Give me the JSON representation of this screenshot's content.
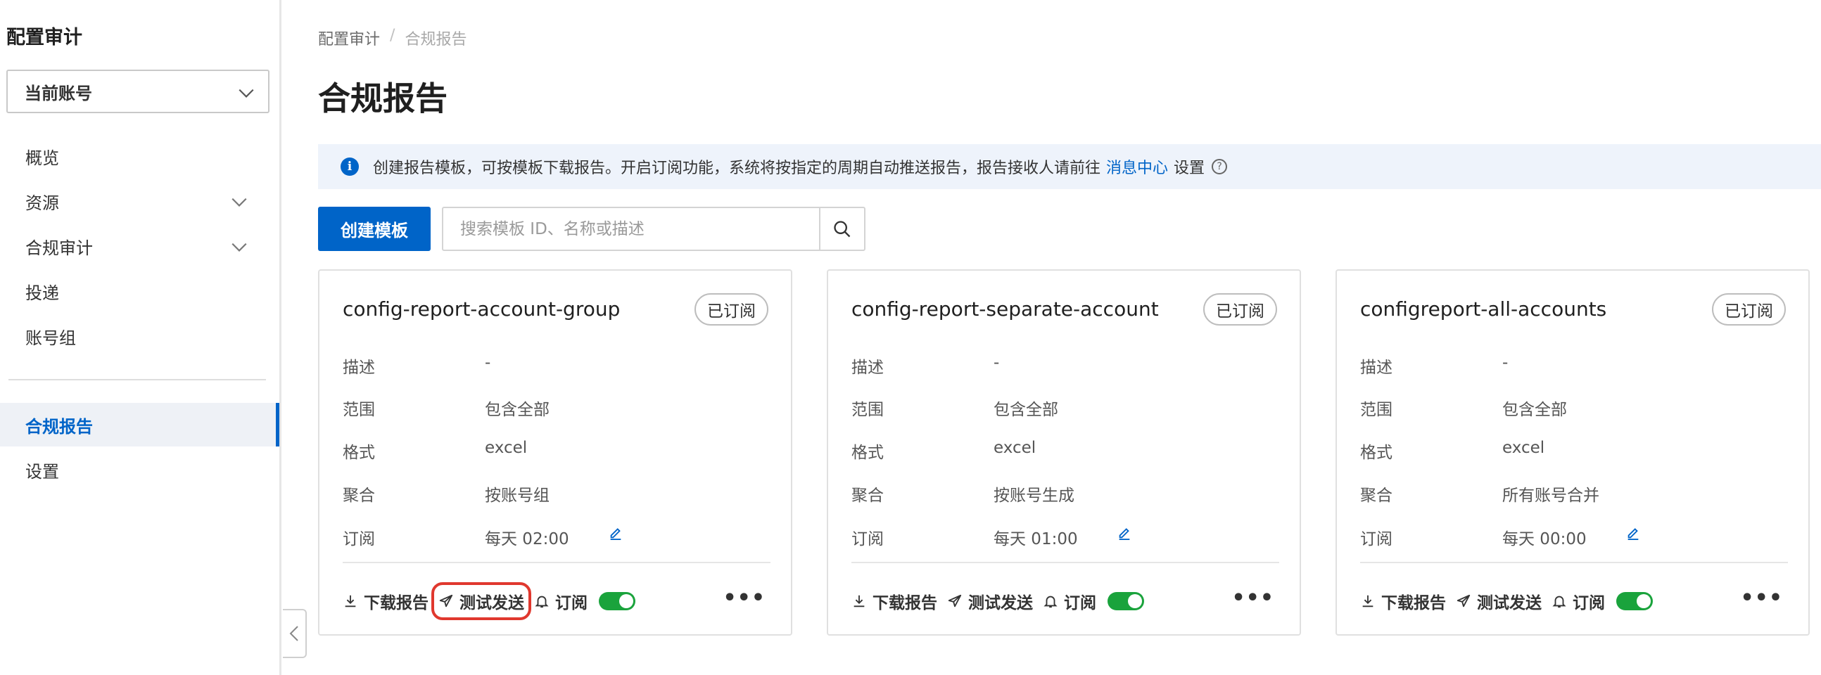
{
  "sidebar": {
    "title": "配置审计",
    "account_select": "当前账号",
    "items": [
      {
        "label": "概览"
      },
      {
        "label": "资源"
      },
      {
        "label": "合规审计"
      },
      {
        "label": "投递"
      },
      {
        "label": "账号组"
      },
      {
        "label": "合规报告"
      },
      {
        "label": "设置"
      }
    ]
  },
  "breadcrumb": {
    "root": "配置审计",
    "separator": "/",
    "current": "合规报告"
  },
  "page_title": "合规报告",
  "info_bar": {
    "text": "创建报告模板，可按模板下载报告。开启订阅功能，系统将按指定的周期自动推送报告，报告接收人请前往",
    "link": "消息中心",
    "suffix": "设置",
    "info_icon": "i",
    "help_icon": "?"
  },
  "toolbar": {
    "create_label": "创建模板",
    "search_placeholder": "搜索模板 ID、名称或描述"
  },
  "card_labels": {
    "desc": "描述",
    "scope": "范围",
    "format": "格式",
    "aggregate": "聚合",
    "subscribe": "订阅"
  },
  "card_actions": {
    "download": "下载报告",
    "test_send": "测试发送",
    "subscribe": "订阅",
    "more": "•••"
  },
  "cards": [
    {
      "title": "config-report-account-group",
      "badge": "已订阅",
      "desc": "-",
      "scope": "包含全部",
      "format": "excel",
      "aggregate": "按账号组",
      "subscribe": "每天 02:00",
      "toggle_on": true
    },
    {
      "title": "config-report-separate-account",
      "badge": "已订阅",
      "desc": "-",
      "scope": "包含全部",
      "format": "excel",
      "aggregate": "按账号生成",
      "subscribe": "每天 01:00",
      "toggle_on": true
    },
    {
      "title": "configreport-all-accounts",
      "badge": "已订阅",
      "desc": "-",
      "scope": "包含全部",
      "format": "excel",
      "aggregate": "所有账号合并",
      "subscribe": "每天 00:00",
      "toggle_on": true
    }
  ],
  "colors": {
    "primary": "#0064c8",
    "toggle_on": "#1aa33c",
    "highlight": "#e0382e"
  }
}
